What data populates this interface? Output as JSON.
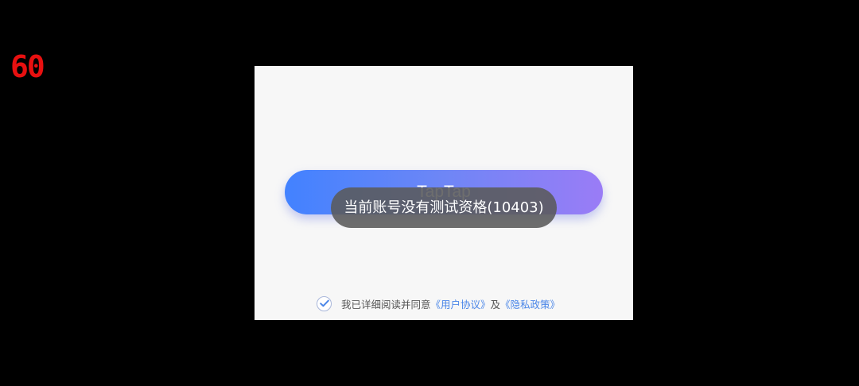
{
  "overlay": {
    "fps": "60"
  },
  "login": {
    "button_label": "TapTap",
    "toast_message": "当前账号没有测试资格(10403)",
    "agreement": {
      "checked": true,
      "prefix_text": "我已详细阅读并同意",
      "user_agreement_link": "《用户协议》",
      "conjunction": "及",
      "privacy_policy_link": "《隐私政策》"
    }
  },
  "icons": {
    "checkbox": "check-icon"
  },
  "colors": {
    "background": "#000000",
    "panel": "#f7f7f7",
    "button_gradient_start": "#4282ff",
    "button_gradient_end": "#9a7cf6",
    "toast": "#5a5a5a",
    "link": "#4a86e8",
    "fps": "#e81010"
  }
}
